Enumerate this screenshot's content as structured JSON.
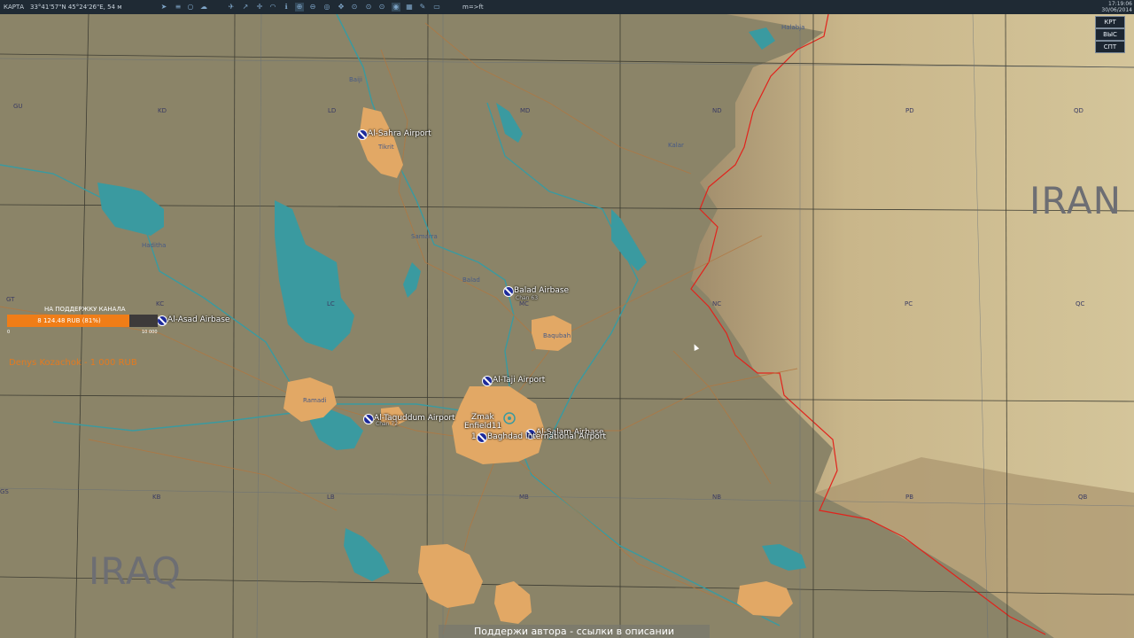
{
  "toolbar": {
    "menu_label": "КАРТА",
    "coords": "33°41'57\"N 45°24'26\"E, 54 м",
    "units": "m=>ft",
    "time": "17:19:06",
    "date": "30/06/2014",
    "tool_icons": [
      "pin-icon",
      "layers-icon",
      "circle-icon",
      "cloud-icon",
      "plane-icon",
      "arrow-icon",
      "target-icon",
      "wifi-icon",
      "info-icon",
      "zoom-in-icon",
      "zoom-out-icon",
      "route-icon",
      "move-icon",
      "zoom-icon",
      "zoom-icon",
      "zoom-icon",
      "globe-icon",
      "grid-icon",
      "pencil-icon"
    ]
  },
  "right_buttons": [
    "КРТ",
    "ВЫС",
    "СПТ"
  ],
  "countries": {
    "iraq": "IRAQ",
    "iran": "IRAN"
  },
  "airbases": [
    {
      "name": "Al-Sahra Airport",
      "sub": ""
    },
    {
      "name": "Balad Airbase",
      "sub": "Chan 63"
    },
    {
      "name": "Al-Asad Airbase",
      "sub": ""
    },
    {
      "name": "Al-Taji Airport",
      "sub": ""
    },
    {
      "name": "Al-Taquddum Airport",
      "sub": "Chan 72"
    },
    {
      "name": "Al-Salam Airbase",
      "sub": ""
    },
    {
      "name": "Baghdad International Airport",
      "sub": ""
    }
  ],
  "units_on_map": {
    "zmak": "Zmak",
    "enfield": "Enfield11",
    "num": "1"
  },
  "towns": [
    "Baiji",
    "Tikrit",
    "Samarra",
    "Balad",
    "Baqubah",
    "Haditha",
    "Ramadi",
    "Kalar",
    "Halabja"
  ],
  "grid_labels": [
    "GU",
    "KD",
    "LD",
    "MD",
    "ND",
    "PD",
    "QD",
    "GT",
    "KC",
    "LC",
    "MC",
    "NC",
    "PC",
    "QC",
    "GS",
    "KB",
    "LB",
    "MB",
    "NB",
    "PB",
    "QB"
  ],
  "donation": {
    "title": "НА ПОДДЕРЖКУ КАНАЛА",
    "amount": "8 124.48 RUB (81%)",
    "min": "0",
    "max": "10 000",
    "progress": 0.81,
    "donor": "Denys Kozachok - 1 000 RUB"
  },
  "subtitle": "Поддержи автора - ссылки в описании",
  "colors": {
    "desert": "#8b8468",
    "water": "#3a9aa0",
    "urban": "#e2a865",
    "border": "#e1231c",
    "terrain_high": "#c9b58c"
  }
}
